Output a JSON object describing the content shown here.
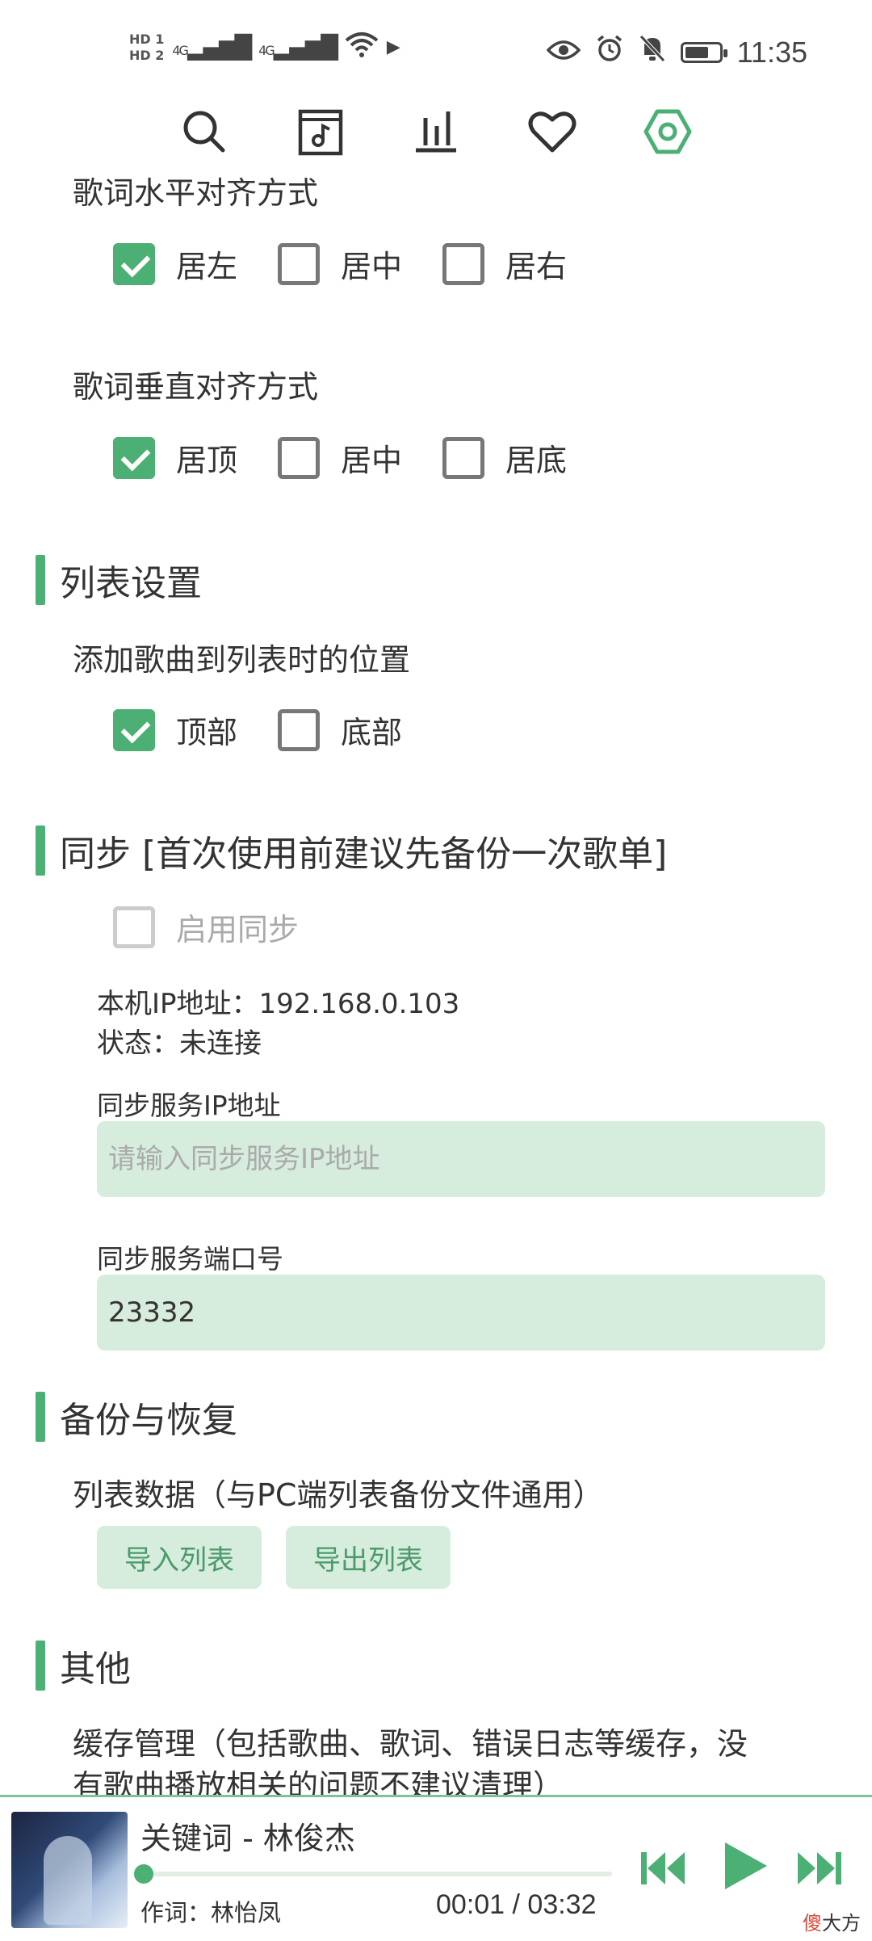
{
  "status_bar": {
    "hd1": "HD 1",
    "hd2": "HD 2",
    "sig1": "4G",
    "sig2": "4G",
    "time": "11:35"
  },
  "nav": [
    "search",
    "music-file",
    "chart",
    "favorite",
    "settings"
  ],
  "colors": {
    "accent": "#4caf74",
    "field_bg": "#d6ecdd"
  },
  "lyric_align": {
    "h_title": "歌词水平对齐方式",
    "h_options": [
      {
        "label": "居左",
        "checked": true
      },
      {
        "label": "居中",
        "checked": false
      },
      {
        "label": "居右",
        "checked": false
      }
    ],
    "v_title": "歌词垂直对齐方式",
    "v_options": [
      {
        "label": "居顶",
        "checked": true
      },
      {
        "label": "居中",
        "checked": false
      },
      {
        "label": "居底",
        "checked": false
      }
    ]
  },
  "list_settings": {
    "title": "列表设置",
    "add_position_title": "添加歌曲到列表时的位置",
    "options": [
      {
        "label": "顶部",
        "checked": true
      },
      {
        "label": "底部",
        "checked": false
      }
    ]
  },
  "sync": {
    "title": "同步 [首次使用前建议先备份一次歌单]",
    "enable_label": "启用同步",
    "local_ip": "本机IP地址：192.168.0.103",
    "status": "状态：未连接",
    "ip_label": "同步服务IP地址",
    "ip_placeholder": "请输入同步服务IP地址",
    "port_label": "同步服务端口号",
    "port_value": "23332"
  },
  "backup": {
    "title": "备份与恢复",
    "desc": "列表数据（与PC端列表备份文件通用）",
    "import_label": "导入列表",
    "export_label": "导出列表"
  },
  "other": {
    "title": "其他",
    "cache_line1": "缓存管理（包括歌曲、歌词、错误日志等缓存，没",
    "cache_line2": "有歌曲播放相关的问题不建议清理）"
  },
  "player": {
    "title": "关键词 - 林俊杰",
    "lyricist": "作词：林怡凤",
    "time": "00:01 / 03:32",
    "progress": 0.005,
    "watermark_red": "傻",
    "watermark_rest": "大方"
  }
}
